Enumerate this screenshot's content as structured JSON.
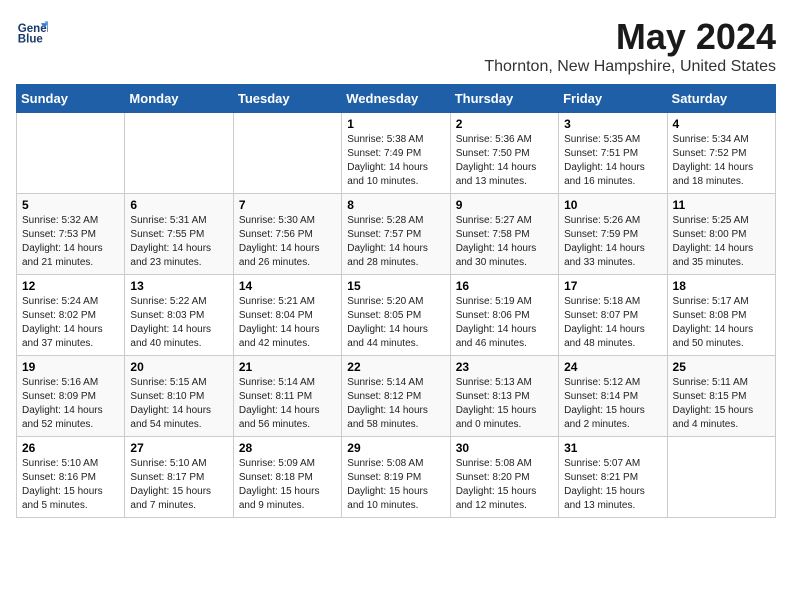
{
  "header": {
    "logo_line1": "General",
    "logo_line2": "Blue",
    "title": "May 2024",
    "subtitle": "Thornton, New Hampshire, United States"
  },
  "days_of_week": [
    "Sunday",
    "Monday",
    "Tuesday",
    "Wednesday",
    "Thursday",
    "Friday",
    "Saturday"
  ],
  "weeks": [
    [
      {
        "num": "",
        "sunrise": "",
        "sunset": "",
        "daylight": ""
      },
      {
        "num": "",
        "sunrise": "",
        "sunset": "",
        "daylight": ""
      },
      {
        "num": "",
        "sunrise": "",
        "sunset": "",
        "daylight": ""
      },
      {
        "num": "1",
        "sunrise": "Sunrise: 5:38 AM",
        "sunset": "Sunset: 7:49 PM",
        "daylight": "Daylight: 14 hours and 10 minutes."
      },
      {
        "num": "2",
        "sunrise": "Sunrise: 5:36 AM",
        "sunset": "Sunset: 7:50 PM",
        "daylight": "Daylight: 14 hours and 13 minutes."
      },
      {
        "num": "3",
        "sunrise": "Sunrise: 5:35 AM",
        "sunset": "Sunset: 7:51 PM",
        "daylight": "Daylight: 14 hours and 16 minutes."
      },
      {
        "num": "4",
        "sunrise": "Sunrise: 5:34 AM",
        "sunset": "Sunset: 7:52 PM",
        "daylight": "Daylight: 14 hours and 18 minutes."
      }
    ],
    [
      {
        "num": "5",
        "sunrise": "Sunrise: 5:32 AM",
        "sunset": "Sunset: 7:53 PM",
        "daylight": "Daylight: 14 hours and 21 minutes."
      },
      {
        "num": "6",
        "sunrise": "Sunrise: 5:31 AM",
        "sunset": "Sunset: 7:55 PM",
        "daylight": "Daylight: 14 hours and 23 minutes."
      },
      {
        "num": "7",
        "sunrise": "Sunrise: 5:30 AM",
        "sunset": "Sunset: 7:56 PM",
        "daylight": "Daylight: 14 hours and 26 minutes."
      },
      {
        "num": "8",
        "sunrise": "Sunrise: 5:28 AM",
        "sunset": "Sunset: 7:57 PM",
        "daylight": "Daylight: 14 hours and 28 minutes."
      },
      {
        "num": "9",
        "sunrise": "Sunrise: 5:27 AM",
        "sunset": "Sunset: 7:58 PM",
        "daylight": "Daylight: 14 hours and 30 minutes."
      },
      {
        "num": "10",
        "sunrise": "Sunrise: 5:26 AM",
        "sunset": "Sunset: 7:59 PM",
        "daylight": "Daylight: 14 hours and 33 minutes."
      },
      {
        "num": "11",
        "sunrise": "Sunrise: 5:25 AM",
        "sunset": "Sunset: 8:00 PM",
        "daylight": "Daylight: 14 hours and 35 minutes."
      }
    ],
    [
      {
        "num": "12",
        "sunrise": "Sunrise: 5:24 AM",
        "sunset": "Sunset: 8:02 PM",
        "daylight": "Daylight: 14 hours and 37 minutes."
      },
      {
        "num": "13",
        "sunrise": "Sunrise: 5:22 AM",
        "sunset": "Sunset: 8:03 PM",
        "daylight": "Daylight: 14 hours and 40 minutes."
      },
      {
        "num": "14",
        "sunrise": "Sunrise: 5:21 AM",
        "sunset": "Sunset: 8:04 PM",
        "daylight": "Daylight: 14 hours and 42 minutes."
      },
      {
        "num": "15",
        "sunrise": "Sunrise: 5:20 AM",
        "sunset": "Sunset: 8:05 PM",
        "daylight": "Daylight: 14 hours and 44 minutes."
      },
      {
        "num": "16",
        "sunrise": "Sunrise: 5:19 AM",
        "sunset": "Sunset: 8:06 PM",
        "daylight": "Daylight: 14 hours and 46 minutes."
      },
      {
        "num": "17",
        "sunrise": "Sunrise: 5:18 AM",
        "sunset": "Sunset: 8:07 PM",
        "daylight": "Daylight: 14 hours and 48 minutes."
      },
      {
        "num": "18",
        "sunrise": "Sunrise: 5:17 AM",
        "sunset": "Sunset: 8:08 PM",
        "daylight": "Daylight: 14 hours and 50 minutes."
      }
    ],
    [
      {
        "num": "19",
        "sunrise": "Sunrise: 5:16 AM",
        "sunset": "Sunset: 8:09 PM",
        "daylight": "Daylight: 14 hours and 52 minutes."
      },
      {
        "num": "20",
        "sunrise": "Sunrise: 5:15 AM",
        "sunset": "Sunset: 8:10 PM",
        "daylight": "Daylight: 14 hours and 54 minutes."
      },
      {
        "num": "21",
        "sunrise": "Sunrise: 5:14 AM",
        "sunset": "Sunset: 8:11 PM",
        "daylight": "Daylight: 14 hours and 56 minutes."
      },
      {
        "num": "22",
        "sunrise": "Sunrise: 5:14 AM",
        "sunset": "Sunset: 8:12 PM",
        "daylight": "Daylight: 14 hours and 58 minutes."
      },
      {
        "num": "23",
        "sunrise": "Sunrise: 5:13 AM",
        "sunset": "Sunset: 8:13 PM",
        "daylight": "Daylight: 15 hours and 0 minutes."
      },
      {
        "num": "24",
        "sunrise": "Sunrise: 5:12 AM",
        "sunset": "Sunset: 8:14 PM",
        "daylight": "Daylight: 15 hours and 2 minutes."
      },
      {
        "num": "25",
        "sunrise": "Sunrise: 5:11 AM",
        "sunset": "Sunset: 8:15 PM",
        "daylight": "Daylight: 15 hours and 4 minutes."
      }
    ],
    [
      {
        "num": "26",
        "sunrise": "Sunrise: 5:10 AM",
        "sunset": "Sunset: 8:16 PM",
        "daylight": "Daylight: 15 hours and 5 minutes."
      },
      {
        "num": "27",
        "sunrise": "Sunrise: 5:10 AM",
        "sunset": "Sunset: 8:17 PM",
        "daylight": "Daylight: 15 hours and 7 minutes."
      },
      {
        "num": "28",
        "sunrise": "Sunrise: 5:09 AM",
        "sunset": "Sunset: 8:18 PM",
        "daylight": "Daylight: 15 hours and 9 minutes."
      },
      {
        "num": "29",
        "sunrise": "Sunrise: 5:08 AM",
        "sunset": "Sunset: 8:19 PM",
        "daylight": "Daylight: 15 hours and 10 minutes."
      },
      {
        "num": "30",
        "sunrise": "Sunrise: 5:08 AM",
        "sunset": "Sunset: 8:20 PM",
        "daylight": "Daylight: 15 hours and 12 minutes."
      },
      {
        "num": "31",
        "sunrise": "Sunrise: 5:07 AM",
        "sunset": "Sunset: 8:21 PM",
        "daylight": "Daylight: 15 hours and 13 minutes."
      },
      {
        "num": "",
        "sunrise": "",
        "sunset": "",
        "daylight": ""
      }
    ]
  ]
}
